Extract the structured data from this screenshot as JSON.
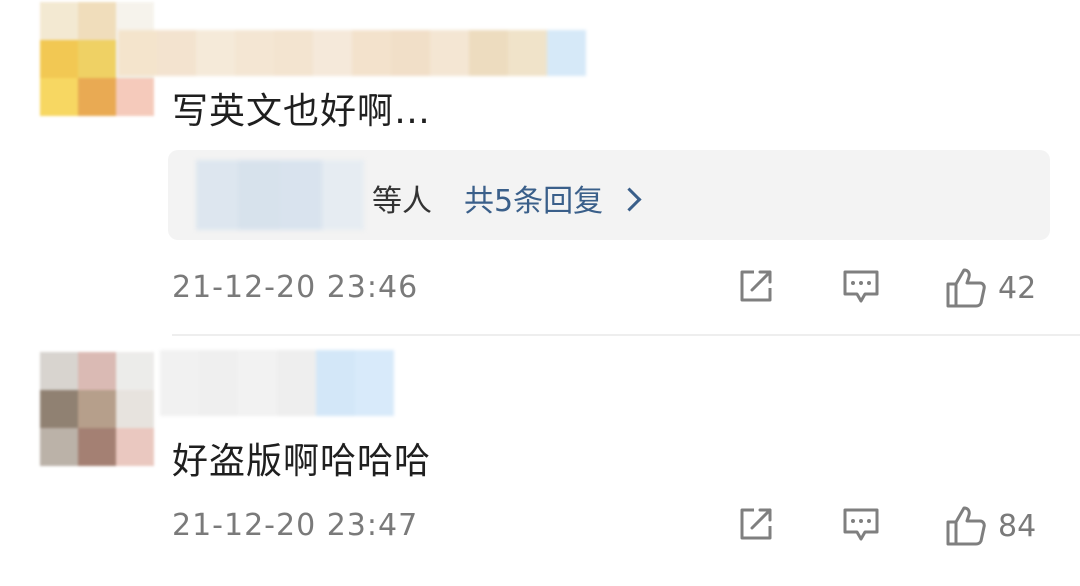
{
  "comments": [
    {
      "text": "写英文也好啊…",
      "reply_suffix": "等人",
      "reply_count_label": "共5条回复",
      "timestamp": "21-12-20 23:46",
      "likes": "42",
      "avatar_colors": [
        "#f3e8d0",
        "#f0dcb8",
        "#f6f3ec",
        "#f2c64a",
        "#efcf5c",
        "#f2efe6",
        "#f7d55a",
        "#e8a64a",
        "#f5c8b8"
      ],
      "name_colors": [
        "#f4e4cc",
        "#f3e3cf",
        "#f5ead9",
        "#f4e6d3",
        "#f3e4d0",
        "#f5e9da",
        "#f3e2cc",
        "#f1dfc8",
        "#f4e6d3",
        "#eddcbf",
        "#f0e3c9",
        "#d6e9f8"
      ]
    },
    {
      "text": "好盗版啊哈哈哈",
      "timestamp": "21-12-20 23:47",
      "likes": "84",
      "avatar_colors": [
        "#d6d2cd",
        "#d9b7b0",
        "#ecebe9",
        "#8b7b6b",
        "#b39a85",
        "#e6e2dd",
        "#b8aea4",
        "#a07a6c",
        "#e9c6bd"
      ],
      "name_colors": [
        "#f1f1f1",
        "#efefef",
        "#f2f2f2",
        "#eeeeee",
        "#d3e7f8",
        "#d8eafa"
      ]
    }
  ],
  "reply_mosaic_colors": [
    "#dde6ef",
    "#d7e2ec",
    "#d9e3ee",
    "#e6ecf2"
  ],
  "icons": {
    "share": "share-icon",
    "reply": "comment-icon",
    "like": "thumbs-up-icon"
  }
}
